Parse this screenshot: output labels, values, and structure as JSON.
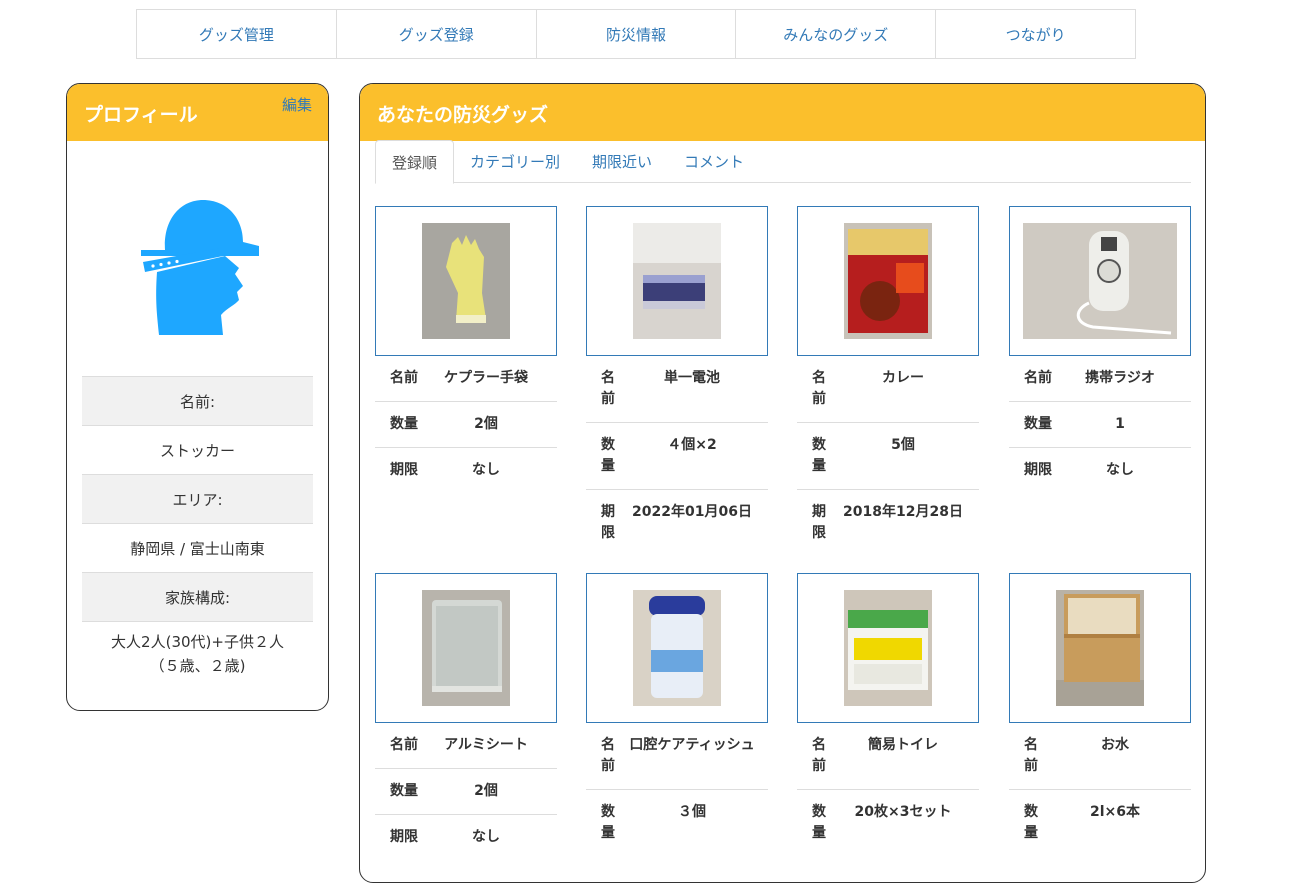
{
  "nav": {
    "items": [
      "グッズ管理",
      "グッズ登録",
      "防災情報",
      "みんなのグッズ",
      "つながり"
    ]
  },
  "profile": {
    "title": "プロフィール",
    "edit_label": "編集",
    "avatar_icon": "helmet-person-icon",
    "name_label": "名前:",
    "name_value": "ストッカー",
    "area_label": "エリア:",
    "area_value": "静岡県 / 富士山南東",
    "family_label": "家族構成:",
    "family_value_line1": "大人2人(30代)+子供２人",
    "family_value_line2": "（５歳、２歳)"
  },
  "goods": {
    "title": "あなたの防災グッズ",
    "tabs": [
      "登録順",
      "カテゴリー別",
      "期限近い",
      "コメント"
    ],
    "labels": {
      "name": "名前",
      "qty": "数量",
      "expiry": "期限",
      "name_split": [
        "名",
        "前"
      ],
      "qty_split": [
        "数",
        "量"
      ],
      "expiry_split": [
        "期",
        "限"
      ]
    },
    "items": [
      {
        "name": "ケプラー手袋",
        "qty": "2個",
        "expiry": "なし"
      },
      {
        "name": "単一電池",
        "qty": "４個×2",
        "expiry": "2022年01月06日"
      },
      {
        "name": "カレー",
        "qty": "5個",
        "expiry": "2018年12月28日"
      },
      {
        "name": "携帯ラジオ",
        "qty": "1",
        "expiry": "なし"
      },
      {
        "name": "アルミシート",
        "qty": "2個",
        "expiry": "なし"
      },
      {
        "name": "口腔ケアティッシュ",
        "qty": "３個",
        "expiry": ""
      },
      {
        "name": "簡易トイレ",
        "qty": "20枚×3セット",
        "expiry": ""
      },
      {
        "name": "お水",
        "qty": "2l×6本",
        "expiry": ""
      }
    ]
  },
  "colors": {
    "accent": "#fbbf2c",
    "link": "#337ab7",
    "avatar": "#1ea7ff"
  }
}
